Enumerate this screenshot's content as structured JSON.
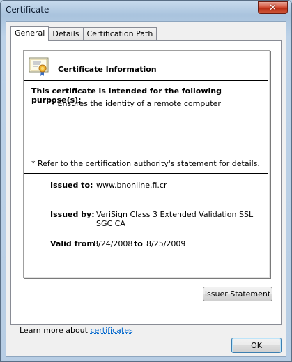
{
  "window": {
    "title": "Certificate",
    "close_glyph": "✕"
  },
  "tabs": [
    {
      "label": "General",
      "active": true
    },
    {
      "label": "Details",
      "active": false
    },
    {
      "label": "Certification Path",
      "active": false
    }
  ],
  "cert": {
    "icon": "certificate-icon",
    "heading": "Certificate Information",
    "purpose_heading": "This certificate is intended for the following purpose(s):",
    "purposes": [
      "Ensures the identity of a remote computer"
    ],
    "bullet": "•",
    "note": "* Refer to the certification authority's statement for details.",
    "issued_to_label": "Issued to:",
    "issued_to_value": "www.bnonline.fi.cr",
    "issued_by_label": "Issued by:",
    "issued_by_value": "VeriSign Class 3 Extended Validation SSL SGC CA",
    "valid_from_label": "Valid from",
    "valid_from_value": "8/24/2008",
    "valid_to_label": "to",
    "valid_to_value": "8/25/2009"
  },
  "buttons": {
    "issuer_statement": "Issuer Statement",
    "ok": "OK"
  },
  "footer": {
    "learn_text": "Learn more about",
    "learn_link": "certificates"
  }
}
